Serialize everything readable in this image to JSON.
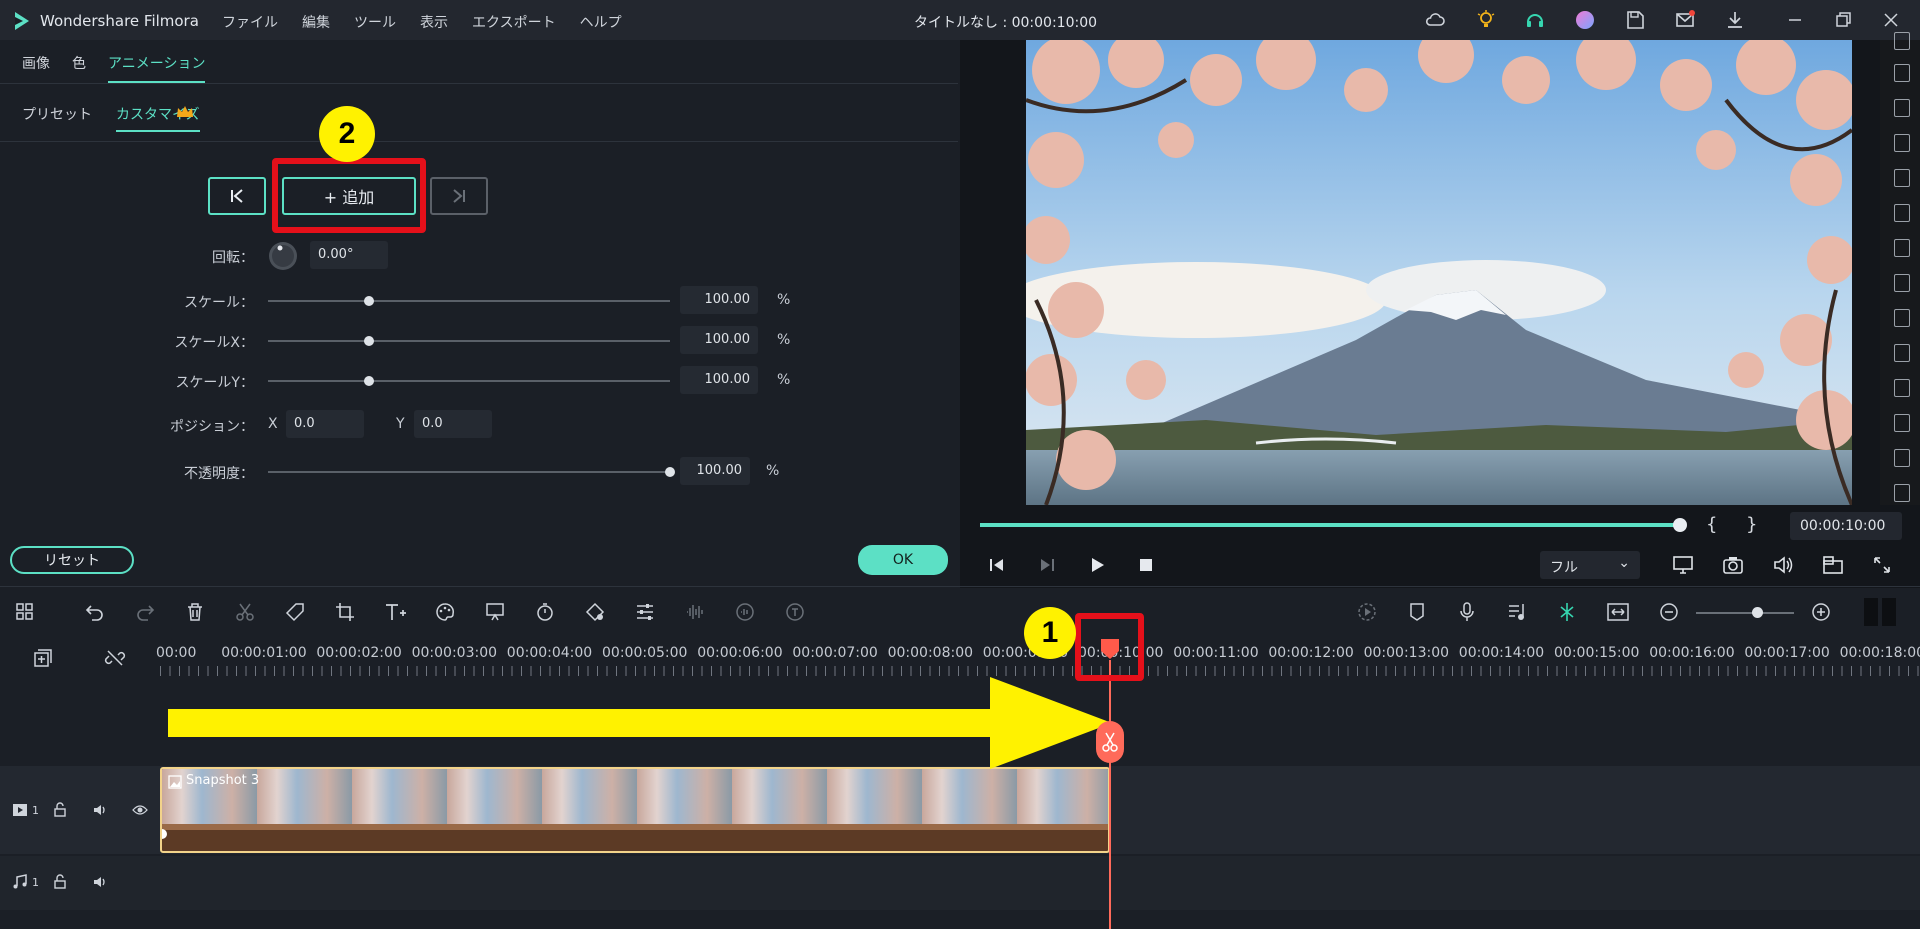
{
  "app": {
    "name": "Wondershare Filmora",
    "window_title": "タイトルなし : 00:00:10:00"
  },
  "menu": [
    "ファイル",
    "編集",
    "ツール",
    "表示",
    "エクスポート",
    "ヘルプ"
  ],
  "tabs_top": [
    "画像",
    "色",
    "アニメーション"
  ],
  "tabs_sub": [
    "プリセット",
    "カスタマイズ"
  ],
  "keyframe": {
    "add_label": "+ 追加",
    "prev_label": "|<",
    "next_label": ">|"
  },
  "badges": {
    "one": "1",
    "two": "2"
  },
  "props": {
    "rotation": {
      "label": "回転：",
      "value": "0.00°"
    },
    "scale": {
      "label": "スケール：",
      "value": "100.00",
      "unit": "%",
      "level": 0.25
    },
    "scale_x": {
      "label": "スケールX：",
      "value": "100.00",
      "unit": "%",
      "level": 0.25
    },
    "scale_y": {
      "label": "スケールY：",
      "value": "100.00",
      "unit": "%",
      "level": 0.25
    },
    "position": {
      "label": "ポジション：",
      "x_label": "X",
      "x_value": "0.0",
      "y_label": "Y",
      "y_value": "0.0"
    },
    "opacity": {
      "label": "不透明度：",
      "value": "100.00",
      "unit": "%",
      "level": 1.0
    }
  },
  "buttons": {
    "reset": "リセット",
    "ok": "OK"
  },
  "player": {
    "time": "00:00:10:00",
    "quality": "フル",
    "bracket_in": "{",
    "bracket_out": "}",
    "progress": 1.0
  },
  "ruler": [
    "00:00",
    "00:00:01:00",
    "00:00:02:00",
    "00:00:03:00",
    "00:00:04:00",
    "00:00:05:00",
    "00:00:06:00",
    "00:00:07:00",
    "00:00:08:00",
    "00:00:09:00",
    "00:00:10:00",
    "00:00:11:00",
    "00:00:12:00",
    "00:00:13:00",
    "00:00:14:00",
    "00:00:15:00",
    "00:00:16:00",
    "00:00:17:00",
    "00:00:18:00"
  ],
  "tracks": {
    "video": {
      "num": "1",
      "clip_name": "Snapshot 3"
    },
    "audio": {
      "num": "1"
    }
  },
  "colors": {
    "accent": "#5ce0c5",
    "highlight": "#e5101a",
    "arrow": "#fff200",
    "playhead": "#ff6a5a"
  }
}
